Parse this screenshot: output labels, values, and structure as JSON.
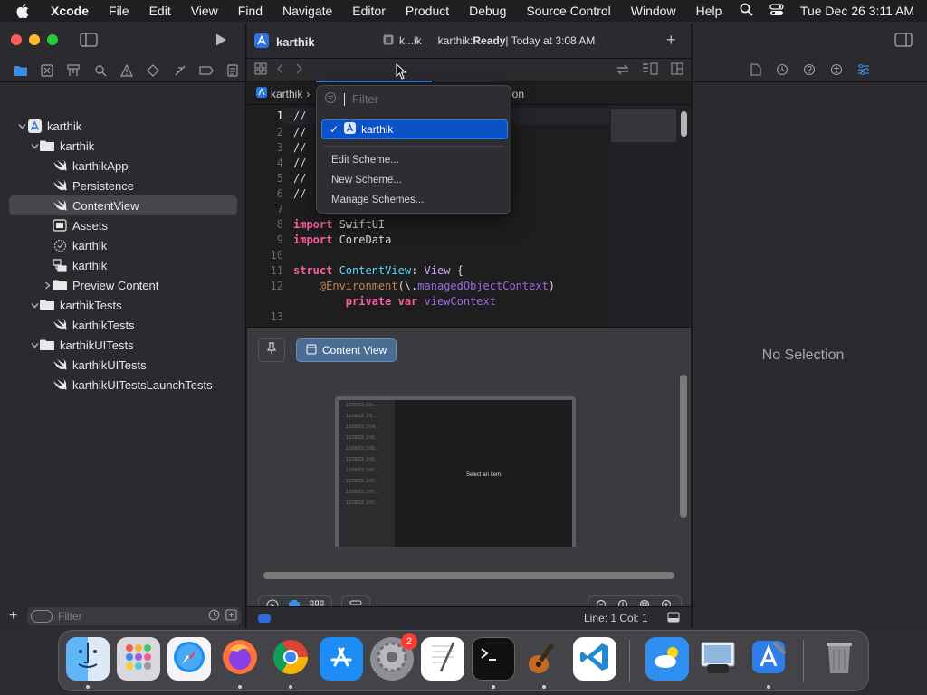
{
  "menubar": {
    "app": "Xcode",
    "items": [
      "File",
      "Edit",
      "View",
      "Find",
      "Navigate",
      "Editor",
      "Product",
      "Debug",
      "Source Control",
      "Window",
      "Help"
    ],
    "datetime": "Tue Dec 26  3:11 AM"
  },
  "toolbar": {
    "project_title": "karthik",
    "scheme_label": "k...ik",
    "status_prefix": "karthik: ",
    "status_state": "Ready",
    "status_time": " | Today at 3:08 AM"
  },
  "navigator": {
    "tree": [
      {
        "label": "karthik",
        "icon": "xcode-project-icon",
        "level": 0,
        "chev": "open"
      },
      {
        "label": "karthik",
        "icon": "folder-icon",
        "level": 1,
        "chev": "open"
      },
      {
        "label": "karthikApp",
        "icon": "swift-file-icon",
        "level": 2,
        "chev": ""
      },
      {
        "label": "Persistence",
        "icon": "swift-file-icon",
        "level": 2,
        "chev": ""
      },
      {
        "label": "ContentView",
        "icon": "swift-file-icon",
        "level": 2,
        "chev": "",
        "selected": true
      },
      {
        "label": "Assets",
        "icon": "asset-catalog-icon",
        "level": 2,
        "chev": ""
      },
      {
        "label": "karthik",
        "icon": "entitlements-icon",
        "level": 2,
        "chev": ""
      },
      {
        "label": "karthik",
        "icon": "data-model-icon",
        "level": 2,
        "chev": ""
      },
      {
        "label": "Preview Content",
        "icon": "folder-icon",
        "level": 2,
        "chev": "closed"
      },
      {
        "label": "karthikTests",
        "icon": "folder-icon",
        "level": 1,
        "chev": "open"
      },
      {
        "label": "karthikTests",
        "icon": "swift-file-icon",
        "level": 2,
        "chev": ""
      },
      {
        "label": "karthikUITests",
        "icon": "folder-icon",
        "level": 1,
        "chev": "open"
      },
      {
        "label": "karthikUITests",
        "icon": "swift-file-icon",
        "level": 2,
        "chev": ""
      },
      {
        "label": "karthikUITestsLaunchTests",
        "icon": "swift-file-icon",
        "level": 2,
        "chev": ""
      }
    ],
    "filter_placeholder": "Filter"
  },
  "breadcrumb": {
    "project": "karthik",
    "tail": "ion"
  },
  "scheme_menu": {
    "filter_placeholder": "Filter",
    "selected_scheme": "karthik",
    "items": [
      "Edit Scheme...",
      "New Scheme...",
      "Manage Schemes..."
    ]
  },
  "code": {
    "line_numbers": [
      "1",
      "2",
      "3",
      "4",
      "5",
      "6",
      "7",
      "8",
      "9",
      "10",
      "11",
      "12",
      "13"
    ],
    "comment_lines": [
      "//",
      "//",
      "//",
      "//",
      "//",
      "//"
    ],
    "kw_import": "import",
    "mod_swiftui": " SwiftUI",
    "mod_coredata": " CoreData",
    "kw_struct": "struct",
    "struct_name": " ContentView",
    "colon_view": ": ",
    "type_view": "View",
    "brace_open": " {",
    "attr_env": "@Environment",
    "env_args": "(\\.",
    "env_prop": "managedObjectContext",
    "env_close": ")",
    "kw_private": "private",
    "kw_var": " var",
    "var_name": " viewContext"
  },
  "preview": {
    "chip_label": "Content View",
    "device_rows": [
      "12/26/23, 2:5...",
      "12/26/23, 2:5...",
      "12/26/23, 3:04...",
      "12/26/23, 3:05...",
      "12/26/23, 3:05...",
      "12/26/23, 3:05...",
      "12/26/23, 3:07...",
      "12/26/23, 3:07...",
      "12/26/23, 3:07...",
      "12/26/23, 3:07..."
    ],
    "device_main": "Select an item"
  },
  "statusbar": {
    "position": "Line: 1  Col: 1"
  },
  "inspector": {
    "empty_text": "No Selection"
  },
  "dock": {
    "apps": [
      "Finder",
      "Launchpad",
      "Safari",
      "Firefox",
      "Chrome",
      "App Store",
      "System Settings",
      "TextEdit",
      "Terminal",
      "Instruments",
      "Visual Studio Code",
      "Weather",
      "Preview",
      "Xcode",
      "Trash"
    ],
    "settings_badge": "2"
  }
}
